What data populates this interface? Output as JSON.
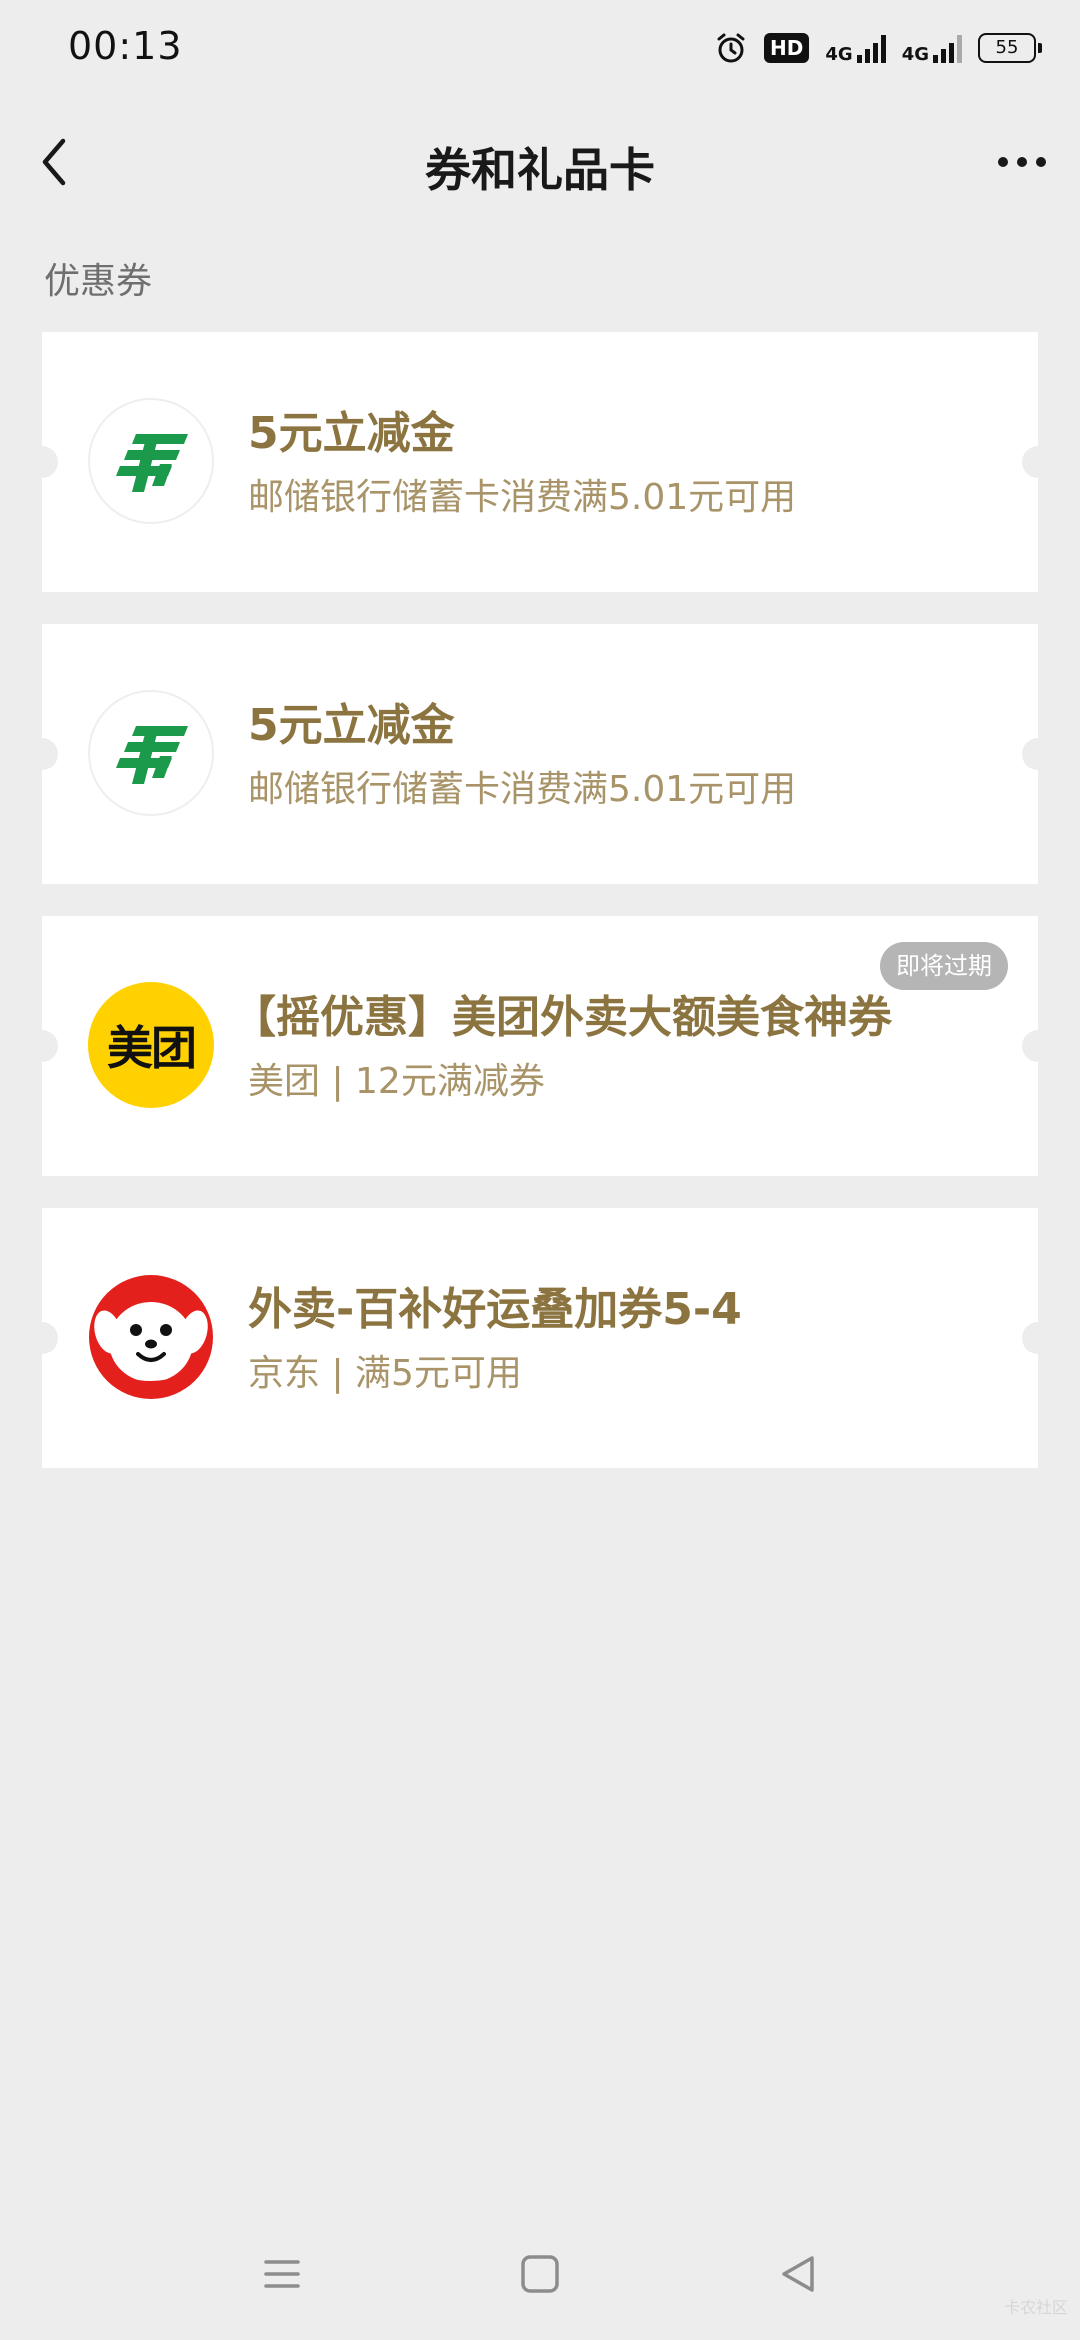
{
  "status_bar": {
    "time": "00:13",
    "hd_label": "HD",
    "network_1": "4G",
    "network_2": "4G",
    "battery": "55"
  },
  "nav": {
    "title": "券和礼品卡"
  },
  "section": {
    "label": "优惠券"
  },
  "coupons": [
    {
      "logo": "china-post-logo",
      "title": "5元立减金",
      "subtitle": "邮储银行储蓄卡消费满5.01元可用",
      "badge": ""
    },
    {
      "logo": "china-post-logo",
      "title": "5元立减金",
      "subtitle": "邮储银行储蓄卡消费满5.01元可用",
      "badge": ""
    },
    {
      "logo": "meituan-logo",
      "logo_text": "美团",
      "title": "【摇优惠】美团外卖大额美食神券",
      "subtitle": "美团 | 12元满减券",
      "badge": "即将过期"
    },
    {
      "logo": "jd-logo",
      "title": "外卖-百补好运叠加券5-4",
      "subtitle": "京东 | 满5元可用",
      "badge": ""
    }
  ],
  "watermark": "卡农社区",
  "colors": {
    "background": "#ededed",
    "card": "#ffffff",
    "coupon_title": "#8b7440",
    "coupon_subtitle": "#a89468",
    "post_green": "#1a9a4a",
    "meituan_yellow": "#ffd100",
    "jd_red": "#e4201c"
  }
}
